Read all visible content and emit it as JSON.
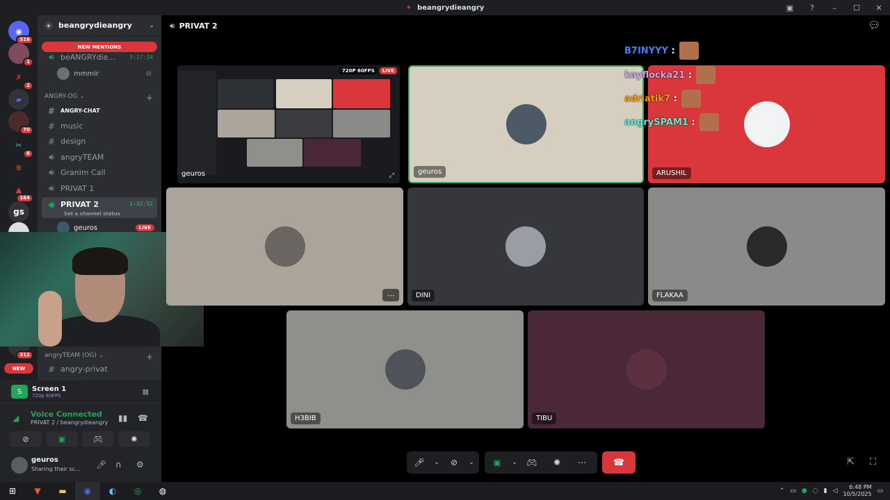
{
  "window": {
    "title": "beangrydieangry"
  },
  "rail": {
    "badges": [
      "516",
      "1",
      "2",
      "70",
      "6",
      "164",
      "312"
    ],
    "gs_label": "gs",
    "new_label": "NEW"
  },
  "sidebar": {
    "server_name": "beangrydieangry",
    "new_mentions": "NEW MENTIONS",
    "top_voice": {
      "name": "beANGRYdie...",
      "time": "3:17:34"
    },
    "top_member": "mmmir",
    "category1": "ANGRY-OG",
    "channels": [
      {
        "name": "ANGRY-CHAT",
        "type": "text"
      },
      {
        "name": "music",
        "type": "text"
      },
      {
        "name": "design",
        "type": "text"
      },
      {
        "name": "angryTEAM",
        "type": "voice"
      },
      {
        "name": "Granim Call",
        "type": "voice"
      },
      {
        "name": "PRIVAT 1",
        "type": "voice"
      }
    ],
    "active_channel": {
      "name": "PRIVAT 2",
      "time": "1:32:52",
      "status": "Set a channel status"
    },
    "active_member": {
      "name": "geuros",
      "live": "LIVE"
    },
    "category2": "angryTEAM (OG)",
    "channel_after": "angry-privat"
  },
  "screen_panel": {
    "title": "Screen 1",
    "quality": "720p 60FPS"
  },
  "voice_panel": {
    "status": "Voice Connected",
    "location": "PRIVAT 2 / beangrydieangry"
  },
  "user_panel": {
    "name": "geuros",
    "status": "Sharing their sc..."
  },
  "main": {
    "channel_name": "PRIVAT 2",
    "stream": {
      "label": "geuros",
      "quality": "720P 60FPS",
      "live": "LIVE"
    },
    "tiles": [
      {
        "label": "geuros"
      },
      {
        "label": "ARUSHIL"
      },
      {
        "label": "DINI"
      },
      {
        "label": "FLAKAA"
      },
      {
        "label": "H3BIB"
      },
      {
        "label": "TIBU"
      }
    ],
    "chat": [
      {
        "user": "B7INYYY",
        "sep": ":",
        "color": "#3b82f6"
      },
      {
        "user": "kayflocka21",
        "sep": ":",
        "color": "#c4a7e7"
      },
      {
        "user": "adriatik7",
        "sep": ":",
        "color": "#f59e0b"
      },
      {
        "user": "angrySPAM1",
        "sep": ":",
        "color": "#5eead4"
      }
    ]
  },
  "taskbar": {
    "time": "6:48 PM",
    "date": "10/5/2025"
  },
  "colors": {
    "accent_green": "#23a55a",
    "danger": "#da373c",
    "blurple": "#5865f2"
  }
}
